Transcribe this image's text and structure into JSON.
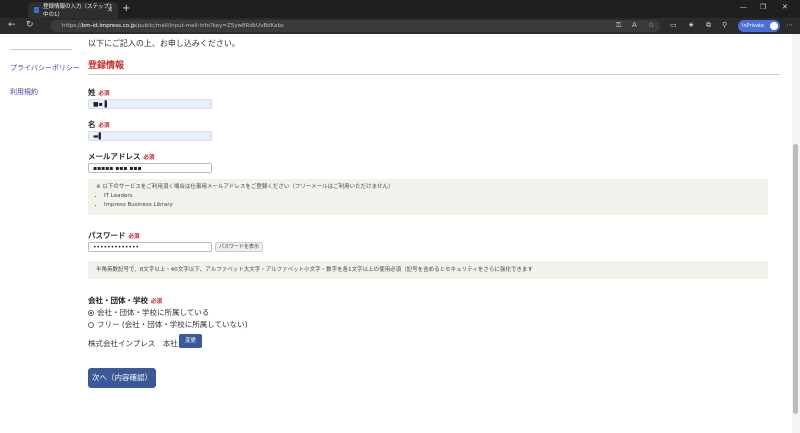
{
  "browser": {
    "tab_title": "登録情報の入力（ステップ1中の1）",
    "url_prefix": "https://",
    "url_host": "bm-id.impress.co.jp",
    "url_path": "/public/mail/input-mail-info?key=Z5yw8RdkUvBdKabc",
    "profile_label": "InPrivate",
    "icons": [
      "back-icon",
      "refresh-icon",
      "lock-icon",
      "favorites-icon",
      "profile-icon"
    ]
  },
  "sidebar": {
    "items": [
      {
        "label": "プライバシーポリシー"
      },
      {
        "label": "利用規約"
      }
    ]
  },
  "form": {
    "intro": "以下にご記入の上、お申し込みください。",
    "section_title": "登録情報",
    "required_label": "必須",
    "last_name": {
      "label": "姓",
      "value": "■▪ ▌"
    },
    "first_name": {
      "label": "名",
      "value": "▬▌"
    },
    "email": {
      "label": "メールアドレス",
      "value": "▪▪▪▪▪ ▪▪▪ ▪▪▪",
      "note": "※ 以下のサービスをご利用頂く場合は仕事用メールアドレスをご登録ください（フリーメールはご利用いただけません）",
      "services": [
        "IT Leaders",
        "Impress Business Library"
      ]
    },
    "password": {
      "label": "パスワード",
      "value": "•••••••••••••",
      "show_label": "パスワードを表示",
      "note": "半角英数記号で、8文字以上・40文字以下、アルファベット大文字・アルファベット小文字・数字を各1文字以上の使用必須（記号を含めるとセキュリティをさらに強化できます"
    },
    "org": {
      "label": "会社・団体・学校",
      "options": [
        {
          "label": "会社・団体・学校に所属している",
          "selected": true
        },
        {
          "label": "フリー (会社・団体・学校に所属していない)",
          "selected": false
        }
      ],
      "company": "株式会社インプレス　本社",
      "change_label": "変更"
    },
    "next_label": "次へ（内容確認）"
  }
}
